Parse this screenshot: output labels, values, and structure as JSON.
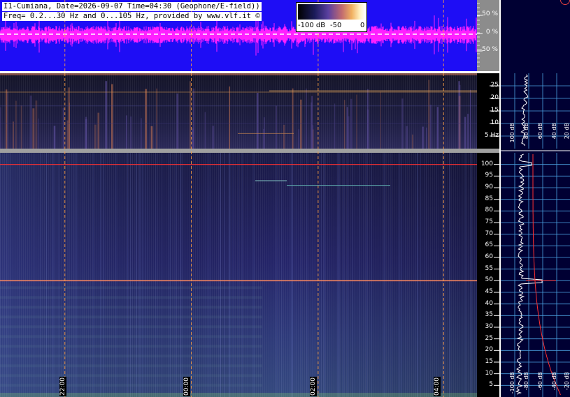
{
  "header": {
    "line1": "I1-Cumiana, Date=2026-09-07 Time=04:30 (Geophone/E-field))",
    "line2": "Freq= 0.2...30 Hz and 0...105 Hz, provided by www.vlf.it ©"
  },
  "colorbar": {
    "labels": [
      "-100 dB",
      "-50",
      "0"
    ]
  },
  "waveform_axis": {
    "labels": [
      "50 %",
      "0 %",
      "-50 %"
    ]
  },
  "lf_axis": {
    "labels": [
      "25",
      "20",
      "15",
      "10",
      "5 Hz"
    ],
    "values": [
      25,
      20,
      15,
      10,
      5
    ],
    "range": [
      0,
      30
    ]
  },
  "hf_axis": {
    "labels": [
      "100",
      "95",
      "90",
      "85",
      "80",
      "75",
      "70",
      "65",
      "60",
      "55",
      "50",
      "45",
      "40",
      "35",
      "30",
      "25",
      "20",
      "15",
      "10",
      "5"
    ],
    "values": [
      100,
      95,
      90,
      85,
      80,
      75,
      70,
      65,
      60,
      55,
      50,
      45,
      40,
      35,
      30,
      25,
      20,
      15,
      10,
      5
    ],
    "range": [
      0,
      105
    ]
  },
  "time_labels": [
    "22:00",
    "00:00",
    "02:00",
    "04:00"
  ],
  "time_positions": [
    0.13,
    0.39,
    0.65,
    0.91
  ],
  "db_labels_top": [
    "100 dB",
    "80 dB",
    "60 dB",
    "40 dB",
    "20 dB"
  ],
  "db_labels_bottom": [
    "-100 dB",
    "-80 dB",
    "-60 dB",
    "-40 dB",
    "-20 dB"
  ],
  "colors": {
    "waveform_bg": "#1e0df5",
    "waveform_trace": "#ff20ff",
    "spectro_bg": "#101030",
    "right_panel": "#000033",
    "grid": "#4aa0e0",
    "hum_line": "#ff3030",
    "time_marker": "#ffa040"
  }
}
